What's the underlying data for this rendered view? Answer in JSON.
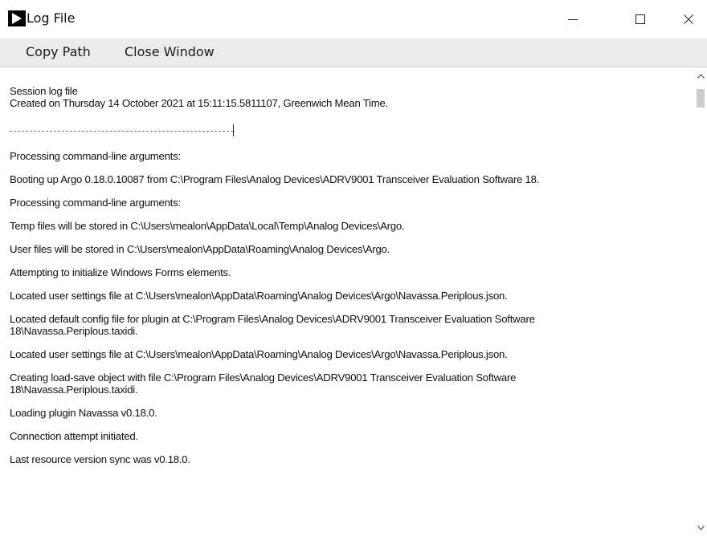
{
  "window": {
    "title": "Log File",
    "icons": {
      "app": "app-icon-black-arrow",
      "minimize": "minimize-icon",
      "maximize": "maximize-icon",
      "close": "close-icon"
    }
  },
  "menu": {
    "copy_path": "Copy Path",
    "close_window": "Close Window"
  },
  "log": {
    "header1": "Session log file",
    "header2": "Created on Thursday 14 October 2021 at 15:11:15.5811107, Greenwich Mean Time.",
    "entries": [
      "Processing command-line arguments:",
      "Booting up Argo 0.18.0.10087 from C:\\Program Files\\Analog Devices\\ADRV9001 Transceiver Evaluation Software 18.",
      "Processing command-line arguments:",
      "Temp files will be stored in C:\\Users\\mealon\\AppData\\Local\\Temp\\Analog Devices\\Argo.",
      "User files will be stored in C:\\Users\\mealon\\AppData\\Roaming\\Analog Devices\\Argo.",
      "Attempting to initialize Windows Forms elements.",
      "Located user settings file at C:\\Users\\mealon\\AppData\\Roaming\\Analog Devices\\Argo\\Navassa.Periplous.json.",
      "Located default config file for plugin at C:\\Program Files\\Analog Devices\\ADRV9001 Transceiver Evaluation Software\n18\\Navassa.Periplous.taxidi.",
      "Located user settings file at C:\\Users\\mealon\\AppData\\Roaming\\Analog Devices\\Argo\\Navassa.Periplous.json.",
      "Creating load-save object with file C:\\Program Files\\Analog Devices\\ADRV9001 Transceiver Evaluation Software\n18\\Navassa.Periplous.taxidi.",
      "Loading plugin Navassa v0.18.0.",
      "Connection attempt initiated.",
      "Last resource version sync was v0.18.0."
    ]
  },
  "scrollbar": {
    "position": 0.02,
    "up_icon": "chevron-up-icon",
    "down_icon": "chevron-down-icon"
  }
}
